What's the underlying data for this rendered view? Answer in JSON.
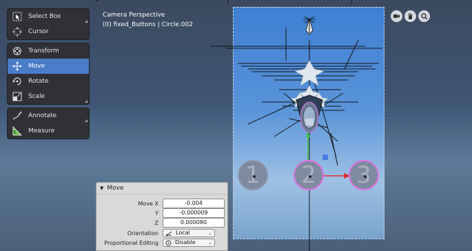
{
  "viewport": {
    "mode_label": "Camera Perspective",
    "object_label": "(0) fixed_Buttons | Circle.002"
  },
  "toolbar": {
    "groups": [
      [
        {
          "label": "Select Box",
          "icon": "select-box-icon"
        },
        {
          "label": "Cursor",
          "icon": "cursor-icon"
        }
      ],
      [
        {
          "label": "Transform",
          "icon": "transform-icon"
        },
        {
          "label": "Move",
          "icon": "move-icon",
          "active": true
        },
        {
          "label": "Rotate",
          "icon": "rotate-icon"
        },
        {
          "label": "Scale",
          "icon": "scale-icon"
        }
      ],
      [
        {
          "label": "Annotate",
          "icon": "annotate-icon"
        },
        {
          "label": "Measure",
          "icon": "measure-icon"
        }
      ]
    ]
  },
  "navigation": {
    "buttons": [
      "camera-view-icon",
      "pan-hand-icon",
      "zoom-icon"
    ]
  },
  "scene": {
    "buttons": [
      {
        "label": "1",
        "selected": false
      },
      {
        "label": "2",
        "selected": true
      },
      {
        "label": "3",
        "selected": true
      }
    ]
  },
  "operator_panel": {
    "title": "Move",
    "move_x_label": "Move X",
    "move_x": "-0.004",
    "y_label": "Y",
    "move_y": "-0.000009",
    "z_label": "Z",
    "move_z": "0.000080",
    "orientation_label": "Orientation",
    "orientation_value": "Local",
    "proportional_label": "Proportional Editing",
    "proportional_value": "Disable"
  },
  "colors": {
    "active_tool": "#4a7dc9",
    "selection_outline": "#e070e0",
    "gizmo_red": "#e23030",
    "gizmo_green": "#3cc43c",
    "gizmo_blue": "#4a7ee0"
  }
}
